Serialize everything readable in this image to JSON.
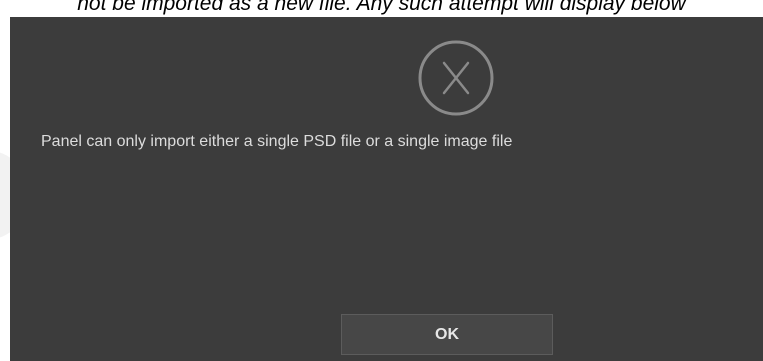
{
  "caption": {
    "text": "not be imported as a new file. Any such attempt will display below"
  },
  "dialog": {
    "icon": "error-x-circle-icon",
    "message": "Panel can only import either a single PSD file or a single image file",
    "ok_label": "OK"
  },
  "colors": {
    "dialog_bg": "#3c3c3c",
    "icon_stroke": "#8a8a8a",
    "button_bg": "#474747",
    "text": "#dcdcdc"
  }
}
